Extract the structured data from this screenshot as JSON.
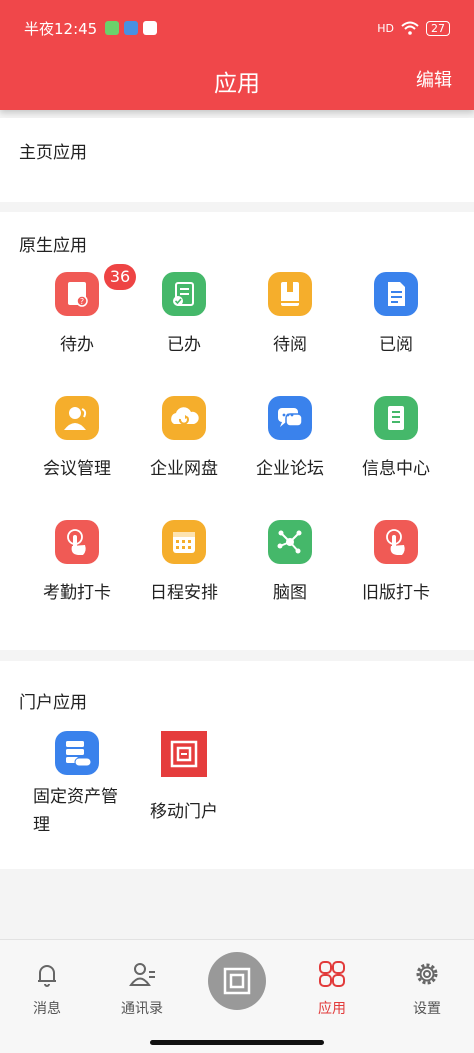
{
  "status_bar": {
    "time": "半夜12:45",
    "battery": "27",
    "signal": "HD"
  },
  "header": {
    "title": "应用",
    "edit": "编辑"
  },
  "sections": {
    "home": {
      "title": "主页应用"
    },
    "native": {
      "title": "原生应用",
      "apps": [
        {
          "label": "待办",
          "badge": "36",
          "icon": "doc-question-icon",
          "color": "#f05a55"
        },
        {
          "label": "已办",
          "icon": "doc-check-icon",
          "color": "#45b86a"
        },
        {
          "label": "待阅",
          "icon": "book-icon",
          "color": "#f5ae2c"
        },
        {
          "label": "已阅",
          "icon": "document-icon",
          "color": "#3a82ec"
        },
        {
          "label": "会议管理",
          "icon": "meeting-person-icon",
          "color": "#f5ae2c"
        },
        {
          "label": "企业网盘",
          "icon": "cloud-icon",
          "color": "#f5ae2c"
        },
        {
          "label": "企业论坛",
          "icon": "chat-bubble-icon",
          "color": "#3a82ec"
        },
        {
          "label": "信息中心",
          "icon": "notebook-icon",
          "color": "#45b86a"
        },
        {
          "label": "考勤打卡",
          "icon": "touch-finger-icon",
          "color": "#f05a55"
        },
        {
          "label": "日程安排",
          "icon": "calendar-icon",
          "color": "#f5ae2c"
        },
        {
          "label": "脑图",
          "icon": "mindmap-icon",
          "color": "#45b86a"
        },
        {
          "label": "旧版打卡",
          "icon": "touch-finger-icon",
          "color": "#f05a55"
        }
      ]
    },
    "portal": {
      "title": "门户应用",
      "apps": [
        {
          "label": "固定资产管理",
          "icon": "saas-server-icon",
          "color": "#3a82ec"
        },
        {
          "label": "移动门户",
          "icon": "portal-logo-icon",
          "color": "#e53c3c"
        }
      ]
    }
  },
  "tabbar": {
    "items": [
      {
        "label": "消息",
        "icon": "bell-icon"
      },
      {
        "label": "通讯录",
        "icon": "contacts-icon"
      },
      {
        "label": "",
        "icon": "center-logo-icon"
      },
      {
        "label": "应用",
        "icon": "apps-grid-icon",
        "active": true
      },
      {
        "label": "设置",
        "icon": "gear-icon"
      }
    ]
  }
}
